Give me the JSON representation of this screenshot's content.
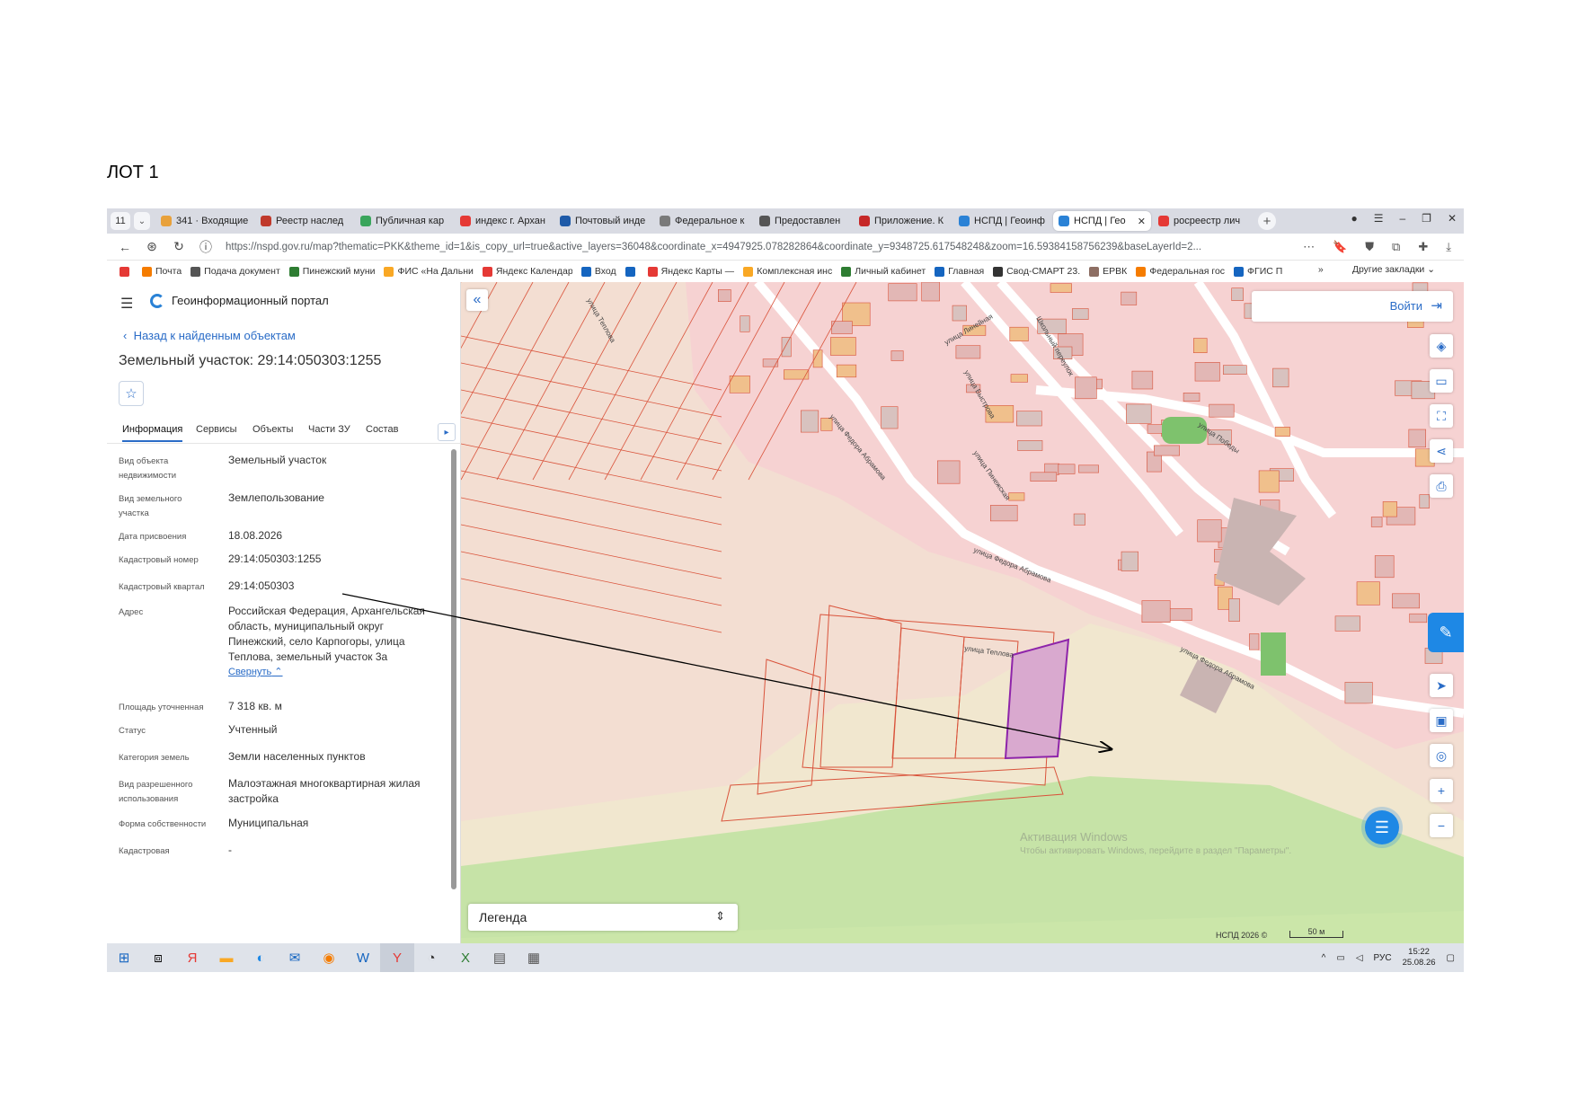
{
  "heading": "ЛОТ 1",
  "browser": {
    "tab_count": "11",
    "tabs": [
      {
        "label": "341 · Входящие",
        "color": "#e8a13b"
      },
      {
        "label": "Реестр наслед",
        "color": "#c0392b"
      },
      {
        "label": "Публичная кар",
        "color": "#3aa55c"
      },
      {
        "label": "индекс г. Архан",
        "color": "#e53935"
      },
      {
        "label": "Почтовый инде",
        "color": "#1e5aa8"
      },
      {
        "label": "Федеральное к",
        "color": "#7a7a7a"
      },
      {
        "label": "Предоставлен",
        "color": "#555555"
      },
      {
        "label": "Приложение. К",
        "color": "#c62828"
      },
      {
        "label": "НСПД | Геоинф",
        "color": "#2a82d6"
      },
      {
        "label": "НСПД | Гео",
        "color": "#2a82d6",
        "active": true
      },
      {
        "label": "росреестр лич",
        "color": "#e53935"
      }
    ],
    "url": "https://nspd.gov.ru/map?thematic=PKK&theme_id=1&is_copy_url=true&active_layers=36048&coordinate_x=4947925.078282864&coordinate_y=9348725.617548248&zoom=16.59384158756239&baseLayerId=2...",
    "bookmarks": [
      {
        "label": "",
        "color": "#e53935"
      },
      {
        "label": "Почта",
        "color": "#f57c00"
      },
      {
        "label": "Подача документ",
        "color": "#555555"
      },
      {
        "label": "Пинежский муни",
        "color": "#2e7d32"
      },
      {
        "label": "ФИС «На Дальни",
        "color": "#f9a825"
      },
      {
        "label": "Яндекс Календар",
        "color": "#e53935"
      },
      {
        "label": "Вход",
        "color": "#1565c0"
      },
      {
        "label": "",
        "color": "#1565c0"
      },
      {
        "label": "Яндекс Карты —",
        "color": "#e53935"
      },
      {
        "label": "Комплексная инс",
        "color": "#f9a825"
      },
      {
        "label": "Личный кабинет",
        "color": "#2e7d32"
      },
      {
        "label": "Главная",
        "color": "#1565c0"
      },
      {
        "label": "Свод-СМАРТ 23.",
        "color": "#333333"
      },
      {
        "label": "ЕРВК",
        "color": "#8d6e63"
      },
      {
        "label": "Федеральная гос",
        "color": "#f57c00"
      },
      {
        "label": "ФГИС П",
        "color": "#1565c0"
      }
    ],
    "bookmarks_more": "»",
    "other_bookmarks": "Другие закладки"
  },
  "panel": {
    "portal_name": "Геоинформационный портал",
    "back_link": "Назад к найденным объектам",
    "title": "Земельный участок: 29:14:050303:1255",
    "tabs": [
      "Информация",
      "Сервисы",
      "Объекты",
      "Части ЗУ",
      "Состав"
    ],
    "props": [
      {
        "label": "Вид объекта недвижимости",
        "value": "Земельный участок"
      },
      {
        "label": "Вид земельного участка",
        "value": "Землепользование"
      },
      {
        "label": "Дата присвоения",
        "value": "18.08.2026"
      },
      {
        "label": "Кадастровый номер",
        "value": "29:14:050303:1255"
      },
      {
        "label": "Кадастровый квартал",
        "value": "29:14:050303"
      },
      {
        "label": "Адрес",
        "value": "Российская Федерация, Архангельская область, муниципальный округ Пинежский, село Карпогоры, улица Теплова, земельный участок 3а",
        "link": "Свернуть"
      },
      {
        "label": "Площадь уточненная",
        "value": "7 318 кв. м"
      },
      {
        "label": "Статус",
        "value": "Учтенный"
      },
      {
        "label": "Категория земель",
        "value": "Земли населенных пунктов"
      },
      {
        "label": "Вид разрешенного использования",
        "value": "Малоэтажная многоквартирная жилая застройка"
      },
      {
        "label": "Форма собственности",
        "value": "Муниципальная"
      },
      {
        "label": "Кадастровая",
        "value": "-"
      }
    ]
  },
  "map": {
    "login_label": "Войти",
    "legend_label": "Легенда",
    "streets": [
      "улица Теплова",
      "улица Федора Абрамова",
      "улица Федора Абрамова",
      "улица Теплова",
      "улица Федора Абрамова",
      "улица Быстрова",
      "улица Линейная",
      "Школьный переулок",
      "улица Победы",
      "улица Пинежская"
    ],
    "windows_activation_title": "Активация Windows",
    "windows_activation_text": "Чтобы активировать Windows, перейдите в раздел \"Параметры\".",
    "copyright": "НСПД 2026 ©",
    "scale": "50 м",
    "selected_parcel_color": "#8e24aa",
    "parcel_line_color": "#d9533b"
  },
  "taskbar": {
    "lang": "РУС",
    "time": "15:22",
    "date": "25.08.26"
  }
}
